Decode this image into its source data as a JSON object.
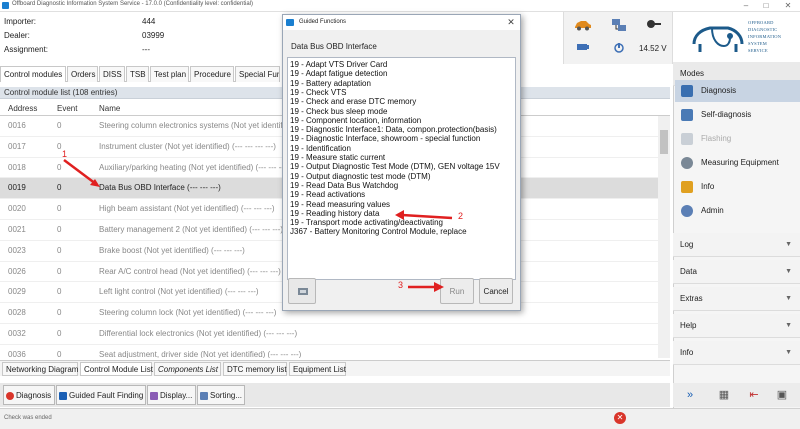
{
  "window": {
    "title": "Offboard Diagnostic Information System Service - 17.0.0 (Confidentiality level: confidential)"
  },
  "header": {
    "importer_label": "Importer:",
    "importer_value": "444",
    "dealer_label": "Dealer:",
    "dealer_value": "03999",
    "assignment_label": "Assignment:",
    "assignment_value": "---",
    "voltage": "14.52 V"
  },
  "logo": {
    "line1": "OFFBOARD",
    "line2": "DIAGNOSTIC",
    "line3": "INFORMATION",
    "line4": "SYSTEM",
    "line5": "SERVICE"
  },
  "tabs": [
    "Control modules",
    "Orders",
    "DISS",
    "TSB",
    "Test plan",
    "Procedure",
    "Special Fun"
  ],
  "control_module_list": {
    "header": "Control module list (108 entries)",
    "columns": [
      "Address",
      "Event",
      "Name"
    ],
    "rows": [
      {
        "address": "0016",
        "event": "0",
        "name": "Steering column electronics systems (Not yet identified)   ---   ---   ---"
      },
      {
        "address": "0017",
        "event": "0",
        "name": "Instrument cluster (Not yet identified)  (---   ---   ---   ---)"
      },
      {
        "address": "0018",
        "event": "0",
        "name": "Auxiliary/parking heating (Not yet identified)   (---   ---   ---)"
      },
      {
        "address": "0019",
        "event": "0",
        "name": "Data Bus OBD Interface   (---   ---   ---)"
      },
      {
        "address": "0020",
        "event": "0",
        "name": "High beam assistant (Not yet identified)   (---   ---   ---)"
      },
      {
        "address": "0021",
        "event": "0",
        "name": "Battery management 2 (Not yet identified)   (---   ---   ---)"
      },
      {
        "address": "0023",
        "event": "0",
        "name": "Brake boost (Not yet identified)   (---   ---   ---)"
      },
      {
        "address": "0026",
        "event": "0",
        "name": "Rear A/C control head (Not yet identified)   (---   ---   ---)"
      },
      {
        "address": "0029",
        "event": "0",
        "name": "Left light control (Not yet identified)   (---   ---   ---)"
      },
      {
        "address": "0028",
        "event": "0",
        "name": "Steering column lock (Not yet identified)   (---   ---   ---)"
      },
      {
        "address": "0032",
        "event": "0",
        "name": "Differential lock electronics (Not yet identified)   (---   ---   ---)"
      },
      {
        "address": "0036",
        "event": "0",
        "name": "Seat adjustment, driver side (Not yet identified)   (---   ---   ---)"
      }
    ]
  },
  "bottom_tabs": [
    "Networking Diagram",
    "Control Module List",
    "Components List",
    "DTC memory list",
    "Equipment List"
  ],
  "toolbar": {
    "diagnosis": "Diagnosis",
    "guided_fault_finding": "Guided Fault Finding",
    "display": "Display...",
    "sorting": "Sorting..."
  },
  "status": "Check was ended",
  "right_panel": {
    "modes_label": "Modes",
    "items": [
      {
        "label": "Diagnosis",
        "icon": "diagnosis-icon"
      },
      {
        "label": "Self-diagnosis",
        "icon": "self-diagnosis-icon"
      },
      {
        "label": "Flashing",
        "icon": "flashing-icon"
      },
      {
        "label": "Measuring Equipment",
        "icon": "measuring-icon"
      },
      {
        "label": "Info",
        "icon": "info-icon"
      },
      {
        "label": "Admin",
        "icon": "admin-icon"
      }
    ],
    "sections": [
      "Log",
      "Data",
      "Extras",
      "Help",
      "Info"
    ]
  },
  "dialog": {
    "title": "Guided Functions",
    "subtitle": "Data Bus OBD Interface",
    "items": [
      "19 - Adapt VTS Driver Card",
      "19 - Adapt fatigue detection",
      "19 - Battery adaptation",
      "19 - Check VTS",
      "19 - Check and erase DTC memory",
      "19 - Check bus sleep mode",
      "19 - Component location, information",
      "19 - Diagnostic Interface1: Data, compon.protection(basis)",
      "19 - Diagnostic Interface, showroom - special function",
      "19 - Identification",
      "19 - Measure static current",
      "19 - Output Diagnostic Test Mode (DTM), GEN voltage 15V",
      "19 - Output diagnostic test mode (DTM)",
      "19 - Read Data Bus Watchdog",
      "19 - Read activations",
      "19 - Read measuring values",
      "19 - Reading history data",
      "19 - Transport mode activating/deactivating",
      "J367 - Battery Monitoring Control Module, replace"
    ],
    "run_label": "Run",
    "cancel_label": "Cancel"
  },
  "annotations": {
    "one": "1",
    "two": "2",
    "three": "3",
    "color": "#e02020"
  }
}
